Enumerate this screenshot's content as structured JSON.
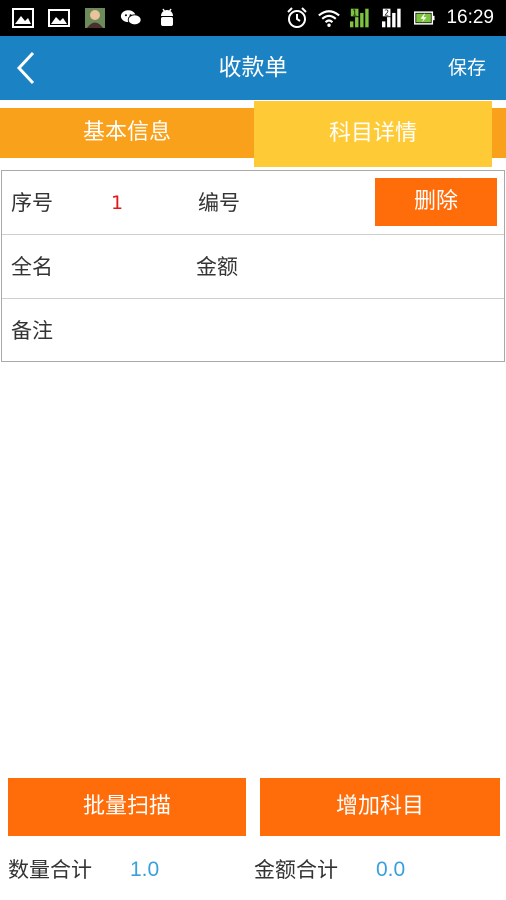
{
  "status_bar": {
    "time": "16:29",
    "icons_left": [
      "image-icon",
      "picture-icon",
      "avatar-icon",
      "wechat-icon",
      "android-icon"
    ],
    "icons_right": [
      "alarm-icon",
      "wifi-icon",
      "signal-sim1-icon",
      "signal-sim2-icon",
      "battery-charging-icon"
    ]
  },
  "header": {
    "title": "收款单",
    "save_label": "保存",
    "back_icon": "chevron-left-icon"
  },
  "tabs": [
    {
      "label": "基本信息",
      "active": false
    },
    {
      "label": "科目详情",
      "active": true
    }
  ],
  "form": {
    "serial_label": "序号",
    "serial_value": "1",
    "code_label": "编号",
    "code_value": "",
    "delete_label": "删除",
    "fullname_label": "全名",
    "fullname_value": "",
    "amount_label": "金额",
    "amount_value": "",
    "remark_label": "备注",
    "remark_value": ""
  },
  "actions": {
    "batch_scan_label": "批量扫描",
    "add_subject_label": "增加科目"
  },
  "summary": {
    "qty_label": "数量合计",
    "qty_value": "1.0",
    "amount_label": "金额合计",
    "amount_value": "0.0"
  },
  "colors": {
    "header_bg": "#1b82c3",
    "tab_bar_bg": "#f9a11b",
    "tab_active_bg": "#fecb37",
    "button_bg": "#ff6d0b",
    "serial_value": "#e11818",
    "summary_value": "#3aa0dd"
  }
}
